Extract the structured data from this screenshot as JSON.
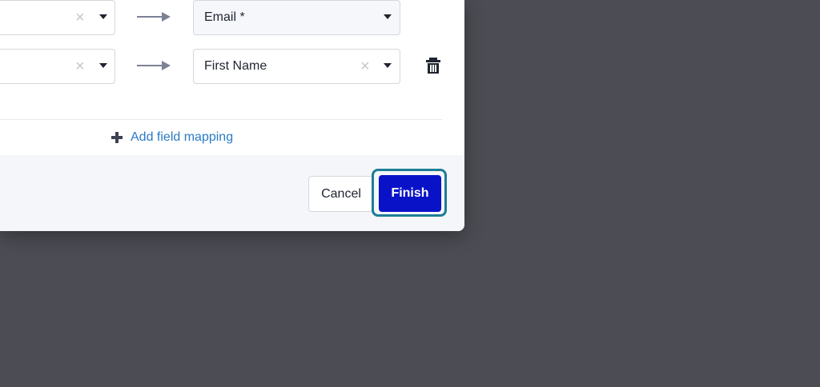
{
  "mappings": [
    {
      "source_value": "",
      "target_value": "Email *"
    },
    {
      "source_value": "",
      "target_value": "First Name"
    }
  ],
  "icons": {
    "clear": "×",
    "caret": "chevron-down-icon",
    "arrow": "arrow-right-icon",
    "delete": "trash-icon",
    "add": "plus-icon"
  },
  "add_mapping_label": "Add field mapping",
  "footer": {
    "cancel_label": "Cancel",
    "finish_label": "Finish"
  },
  "colors": {
    "link": "#2a7bc4",
    "primary_button": "#0a12c8",
    "focus_ring": "#1d7d96",
    "backdrop": "#4c4d54"
  }
}
